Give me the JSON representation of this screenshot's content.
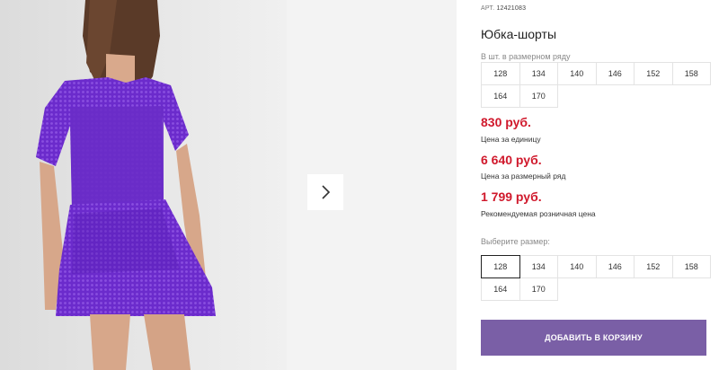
{
  "product": {
    "art_prefix": "АРТ.",
    "art_number": "12421083",
    "title": "Юбка-шорты"
  },
  "row_sizes": {
    "label": "В шт. в размерном ряду",
    "sizes": [
      "128",
      "134",
      "140",
      "146",
      "152",
      "158",
      "164",
      "170"
    ]
  },
  "prices": [
    {
      "amount": "830 руб.",
      "note": "Цена за единицу"
    },
    {
      "amount": "6 640 руб.",
      "note": "Цена за размерный ряд"
    },
    {
      "amount": "1 799 руб.",
      "note": "Рекомендуемая розничная цена"
    }
  ],
  "size_select": {
    "label": "Выберите размер:",
    "sizes": [
      "128",
      "134",
      "140",
      "146",
      "152",
      "158",
      "164",
      "170"
    ],
    "selected": "128"
  },
  "cart_button": {
    "label": "ДОБАВИТЬ В КОРЗИНУ"
  },
  "colors": {
    "price": "#d0192c",
    "cart_button": "#7a5fa6",
    "garment": "#6a2cc8"
  },
  "icons": {
    "next": "chevron-right-icon"
  }
}
